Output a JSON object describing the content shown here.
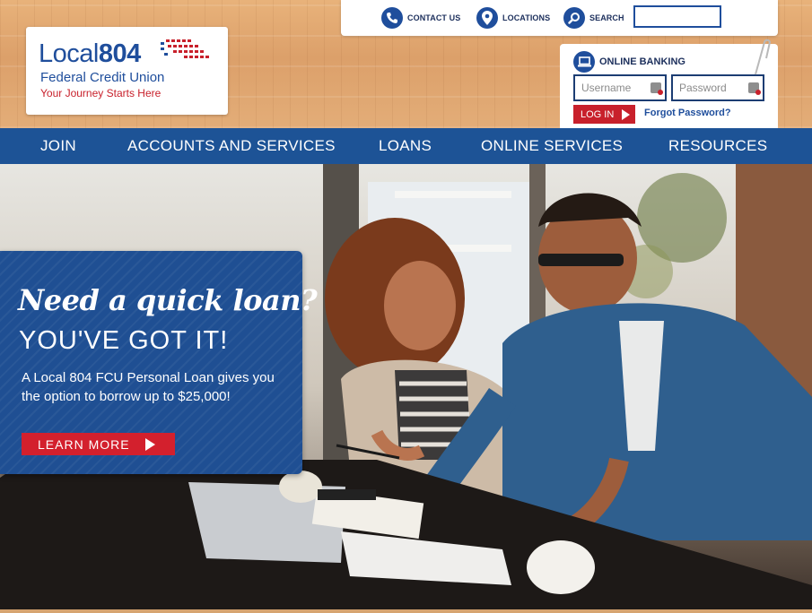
{
  "brand": {
    "name_part1": "Local",
    "name_part2": "804",
    "subtitle": "Federal Credit Union",
    "tagline": "Your Journey Starts Here",
    "primary_color": "#1f4e9c",
    "accent_color": "#c8202b"
  },
  "utility": {
    "contact_label": "CONTACT US",
    "contact_icon": "phone-icon",
    "locations_label": "LOCATIONS",
    "locations_icon": "map-pin-icon",
    "search_label": "SEARCH",
    "search_icon": "magnifier-icon",
    "search_value": ""
  },
  "online_banking": {
    "title": "ONLINE BANKING",
    "icon": "laptop-icon",
    "username_placeholder": "Username",
    "password_placeholder": "Password",
    "login_label": "LOG IN",
    "forgot_label": "Forgot Password?"
  },
  "nav": {
    "items": [
      "JOIN",
      "ACCOUNTS AND SERVICES",
      "LOANS",
      "ONLINE SERVICES",
      "RESOURCES"
    ]
  },
  "promo": {
    "script_heading": "Need a quick loan?",
    "heading": "YOU'VE GOT IT!",
    "body": "A Local 804 FCU Personal Loan gives you the option to borrow up to $25,000!",
    "cta_label": "LEARN MORE"
  }
}
